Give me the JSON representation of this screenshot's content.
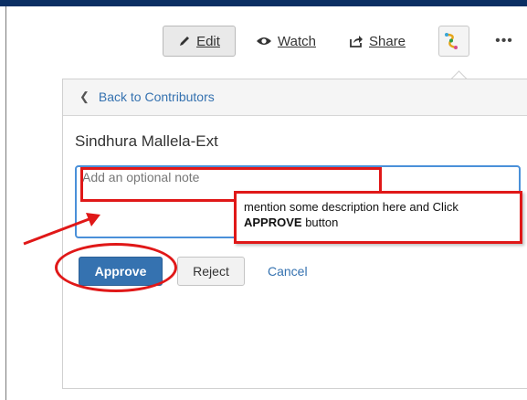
{
  "toolbar": {
    "edit_label": "Edit",
    "watch_label": "Watch",
    "share_label": "Share",
    "more_label": "•••"
  },
  "panel": {
    "back_label": "Back to Contributors",
    "user_name": "Sindhura Mallela-Ext",
    "note_placeholder": "Add an optional note",
    "approve_label": "Approve",
    "reject_label": "Reject",
    "cancel_label": "Cancel"
  },
  "annotation": {
    "callout_line1": "mention some description here and Click",
    "callout_emphasis": "APPROVE",
    "callout_suffix": " button"
  },
  "colors": {
    "accent": "#3572b0",
    "annotation_red": "#e01818",
    "top_strip": "#0b2f63"
  },
  "icons": {
    "edit": "pencil-icon",
    "watch": "eye-icon",
    "share": "share-icon",
    "app": "app-logo-icon",
    "back": "chevron-left-icon"
  }
}
